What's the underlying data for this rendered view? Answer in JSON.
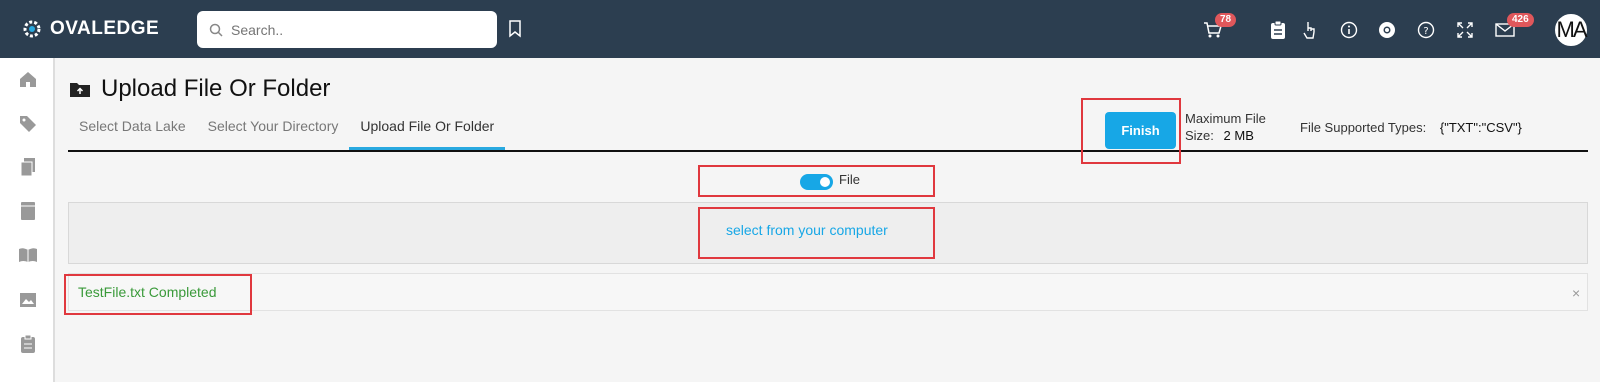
{
  "brand": {
    "logo_text": "OVALEDGE"
  },
  "search": {
    "placeholder": "Search.."
  },
  "topbar_icons": {
    "cart_badge": "78",
    "mail_badge": "426",
    "avatar_initials": "MA"
  },
  "page": {
    "title": "Upload File Or Folder"
  },
  "tabs": [
    {
      "label": "Select Data Lake"
    },
    {
      "label": "Select Your Directory"
    },
    {
      "label": "Upload File Or Folder"
    }
  ],
  "actions": {
    "finish_label": "Finish"
  },
  "limits": {
    "max_size_label_line1": "Maximum File",
    "max_size_label_line2": "Size:",
    "max_size_value": "2 MB",
    "types_label": "File Supported Types:",
    "types_value": "{\"TXT\":\"CSV\"}"
  },
  "upload": {
    "toggle_label": "File",
    "select_link": "select from your computer",
    "file_status": "TestFile.txt Completed",
    "close_glyph": "×"
  },
  "colors": {
    "topbar": "#2c3e50",
    "accent": "#17a7e6",
    "success": "#3a9a3a",
    "highlight": "#e0383e",
    "badge": "#e0575b"
  }
}
